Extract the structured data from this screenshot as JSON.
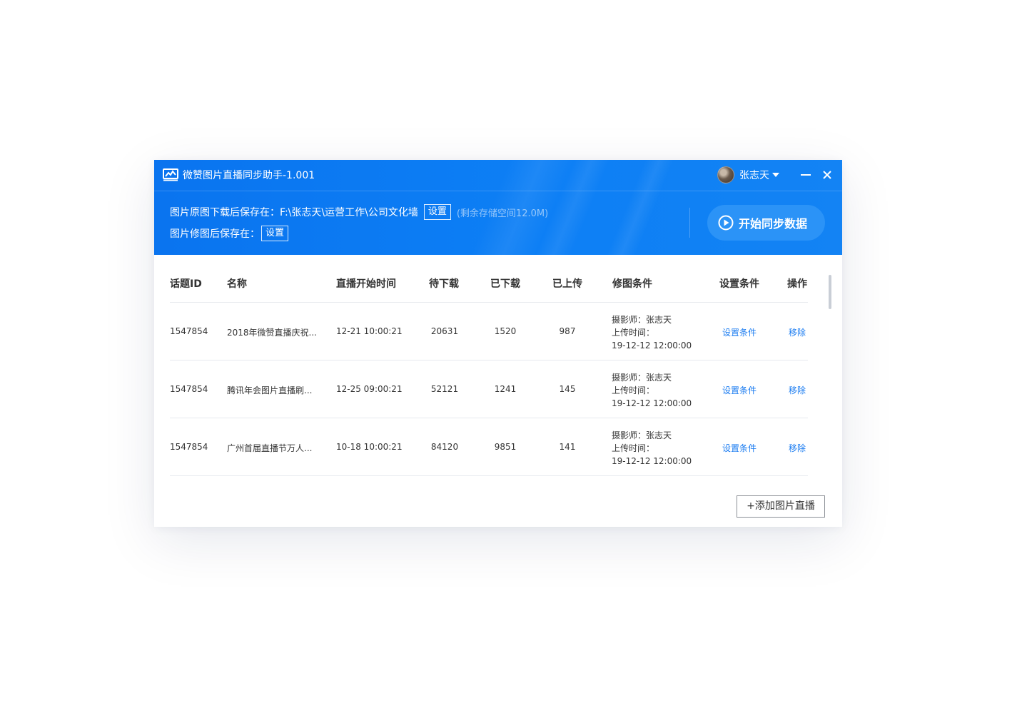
{
  "window": {
    "title": "微赞图片直播同步助手-1.001"
  },
  "user": {
    "name": "张志天"
  },
  "paths": {
    "original_label": "图片原图下载后保存在：F:\\张志天\\运营工作\\公司文化墙",
    "original_set": "设置",
    "storage_note": "(剩余存储空间12.0M)",
    "edited_label": "图片修图后保存在：",
    "edited_set": "设置"
  },
  "sync_button": {
    "label": "开始同步数据"
  },
  "table": {
    "headers": [
      "话题ID",
      "名称",
      "直播开始时间",
      "待下载",
      "已下载",
      "已上传",
      "修图条件",
      "设置条件",
      "操作"
    ],
    "rows": [
      {
        "id": "1547854",
        "name": "2018年微赞直播庆祝...",
        "start": "12-21 10:00:21",
        "pending": "20631",
        "downloaded": "1520",
        "uploaded": "987",
        "cond_photographer": "摄影师：张志天",
        "cond_upload_label": "上传时间：",
        "cond_upload_time": "19-12-12 12:00:00",
        "set_condition": "设置条件",
        "remove": "移除"
      },
      {
        "id": "1547854",
        "name": "腾讯年会图片直播刷...",
        "start": "12-25 09:00:21",
        "pending": "52121",
        "downloaded": "1241",
        "uploaded": "145",
        "cond_photographer": "摄影师：张志天",
        "cond_upload_label": "上传时间：",
        "cond_upload_time": "19-12-12 12:00:00",
        "set_condition": "设置条件",
        "remove": "移除"
      },
      {
        "id": "1547854",
        "name": "广州首届直播节万人...",
        "start": "10-18 10:00:21",
        "pending": "84120",
        "downloaded": "9851",
        "uploaded": "141",
        "cond_photographer": "摄影师：张志天",
        "cond_upload_label": "上传时间：",
        "cond_upload_time": "19-12-12 12:00:00",
        "set_condition": "设置条件",
        "remove": "移除"
      }
    ]
  },
  "add_button": {
    "label": "+添加图片直播"
  },
  "icons": {
    "logo": "app-logo-icon",
    "dropdown": "caret-down-icon",
    "minimize": "minimize-icon",
    "close": "close-icon",
    "play": "play-circle-icon"
  },
  "colors": {
    "header_blue": "#0d7ff5",
    "sync_button": "#2b93f7",
    "link_blue": "#1b7cf1"
  }
}
